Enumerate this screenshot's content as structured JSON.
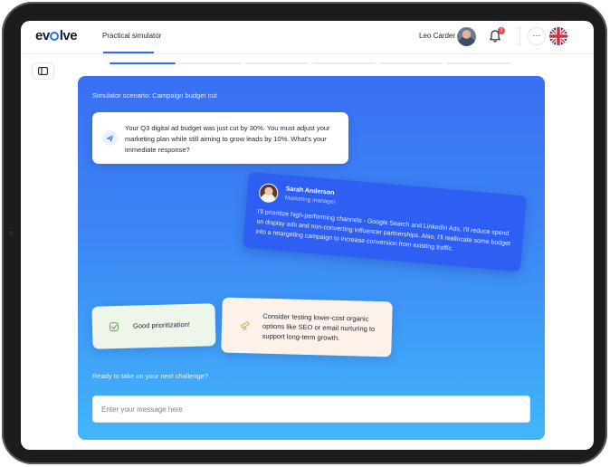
{
  "app": {
    "logo": "evolve"
  },
  "header": {
    "tab_label": "Practical simulator",
    "user_name": "Leo Carder",
    "notification_count": "1",
    "more_label": "···",
    "language_flag": "gb-flag-icon"
  },
  "progress": {
    "total_steps": 6,
    "current_step": 1
  },
  "scenario": {
    "label": "Simulator scenario: Campaign budget cut",
    "question": "Your Q3 digital ad budget was just cut by 30%. You must adjust your marketing plan while still aiming to grow leads by 10%. What's your immediate response?"
  },
  "reply": {
    "name": "Sarah Anderson",
    "role": "Marketing manager",
    "text": "I'll prioritize high-performing channels - Google Search and LinkedIn Ads. I'll reduce spend on display ads and non-converting influencer partnerships. Also, I'll reallocate some budget into a retargeting campaign to increase conversion from existing traffic."
  },
  "feedback": {
    "good": "Good prioritization!",
    "tip": "Consider testing lower-cost organic options like SEO or email nurturing to support long-term growth."
  },
  "footer": {
    "prompt": "Ready to take on your next challenge?",
    "input_placeholder": "Enter your message here",
    "input_value": ""
  },
  "colors": {
    "accent": "#2e6df3",
    "panel_top": "#3a6ff3",
    "panel_bottom": "#42b6fa",
    "good_bg": "#eef6ea",
    "tip_bg": "#fdf2ea"
  }
}
